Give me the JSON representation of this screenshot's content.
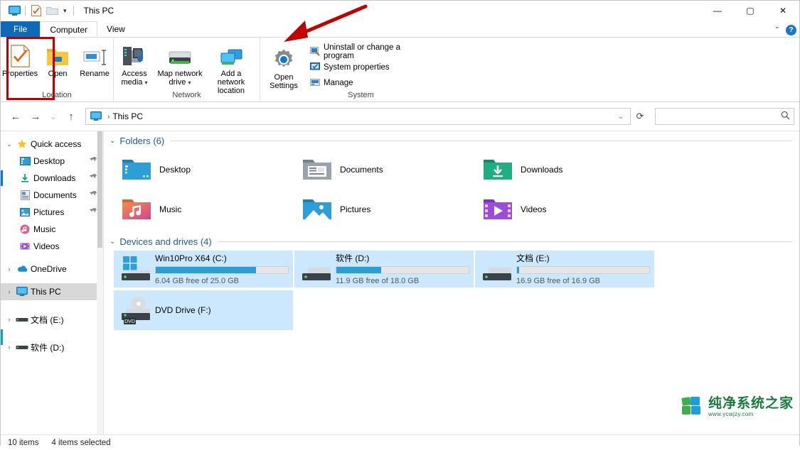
{
  "window": {
    "title": "This PC",
    "quick_access_icons": [
      "this-pc-icon",
      "properties-icon",
      "new-folder-icon"
    ],
    "qat_caret": "▾",
    "minimize": "—",
    "maximize": "▢",
    "close": "✕"
  },
  "ribbon": {
    "tabs": [
      {
        "label": "File",
        "state": "file"
      },
      {
        "label": "Computer",
        "state": "active"
      },
      {
        "label": "View",
        "state": "inactive"
      }
    ],
    "collapse_caret": "⌃",
    "help_label": "?",
    "groups": [
      {
        "name": "Location",
        "label": "Location",
        "buttons": [
          {
            "label": "Properties",
            "icon": "properties-icon"
          },
          {
            "label": "Open",
            "icon": "open-folder-icon"
          },
          {
            "label": "Rename",
            "icon": "rename-icon"
          }
        ]
      },
      {
        "name": "Network",
        "label": "Network",
        "buttons": [
          {
            "label": "Access media",
            "icon": "access-media-icon",
            "caret": "▾"
          },
          {
            "label": "Map network drive",
            "icon": "map-drive-icon",
            "caret": "▾"
          },
          {
            "label": "Add a network location",
            "icon": "add-network-location-icon",
            "caret": ""
          }
        ]
      },
      {
        "name": "System",
        "label": "System",
        "big_button": {
          "label": "Open Settings",
          "icon": "gear-icon",
          "highlighted": true
        },
        "small_buttons": [
          {
            "label": "Uninstall or change a program",
            "icon": "uninstall-icon"
          },
          {
            "label": "System properties",
            "icon": "system-properties-icon"
          },
          {
            "label": "Manage",
            "icon": "manage-icon"
          }
        ]
      }
    ]
  },
  "addressbar": {
    "back": "←",
    "forward": "→",
    "recent": "⌄",
    "up": "↑",
    "crumb_icon": "this-pc-icon",
    "crumb_sep": "›",
    "crumb_text": "This PC",
    "dropdown_caret": "⌄",
    "refresh": "⟳",
    "search_placeholder": "",
    "search_value": "",
    "search_icon": "search-icon"
  },
  "navpane": {
    "items": [
      {
        "label": "Quick access",
        "icon": "star-icon",
        "expander": "⌄",
        "indent": 0,
        "pinned": false,
        "selected": false
      },
      {
        "label": "Desktop",
        "icon": "desktop-icon",
        "expander": "",
        "indent": 1,
        "pinned": true,
        "selected": false
      },
      {
        "label": "Downloads",
        "icon": "downloads-icon",
        "expander": "",
        "indent": 1,
        "pinned": true,
        "selected": false
      },
      {
        "label": "Documents",
        "icon": "documents-icon",
        "expander": "",
        "indent": 1,
        "pinned": true,
        "selected": false
      },
      {
        "label": "Pictures",
        "icon": "pictures-icon",
        "expander": "",
        "indent": 1,
        "pinned": true,
        "selected": false
      },
      {
        "label": "Music",
        "icon": "music-icon",
        "expander": "",
        "indent": 1,
        "pinned": false,
        "selected": false
      },
      {
        "label": "Videos",
        "icon": "videos-icon",
        "expander": "",
        "indent": 1,
        "pinned": false,
        "selected": false
      },
      {
        "label": "OneDrive",
        "icon": "onedrive-icon",
        "expander": "›",
        "indent": 0,
        "pinned": false,
        "selected": false
      },
      {
        "label": "This PC",
        "icon": "this-pc-icon",
        "expander": "›",
        "indent": 0,
        "pinned": false,
        "selected": true
      },
      {
        "label": "文档 (E:)",
        "icon": "drive-icon",
        "expander": "›",
        "indent": 0,
        "pinned": false,
        "selected": false
      },
      {
        "label": "软件 (D:)",
        "icon": "drive-icon",
        "expander": "›",
        "indent": 0,
        "pinned": false,
        "selected": false
      }
    ]
  },
  "content": {
    "folders_group": {
      "chevron": "⌄",
      "title": "Folders (6)",
      "items": [
        {
          "label": "Desktop",
          "icon": "desktop-folder-icon"
        },
        {
          "label": "Documents",
          "icon": "documents-folder-icon"
        },
        {
          "label": "Downloads",
          "icon": "downloads-folder-icon"
        },
        {
          "label": "Music",
          "icon": "music-folder-icon"
        },
        {
          "label": "Pictures",
          "icon": "pictures-folder-icon"
        },
        {
          "label": "Videos",
          "icon": "videos-folder-icon"
        }
      ]
    },
    "drives_group": {
      "chevron": "⌄",
      "title": "Devices and drives (4)",
      "items": [
        {
          "name": "Win10Pro X64 (C:)",
          "free_text": "6.04 GB free of 25.0 GB",
          "used_percent": 76,
          "has_bar": true,
          "selected": true,
          "icon": "windows-drive-icon"
        },
        {
          "name": "软件 (D:)",
          "free_text": "11.9 GB free of 18.0 GB",
          "used_percent": 34,
          "has_bar": true,
          "selected": true,
          "icon": "drive-icon"
        },
        {
          "name": "文档 (E:)",
          "free_text": "16.9 GB free of 16.9 GB",
          "used_percent": 1,
          "has_bar": true,
          "selected": true,
          "icon": "drive-icon"
        },
        {
          "name": "DVD Drive (F:)",
          "free_text": "",
          "used_percent": 0,
          "has_bar": false,
          "selected": true,
          "icon": "dvd-drive-icon"
        }
      ]
    }
  },
  "statusbar": {
    "item_count": "10 items",
    "selection": "4 items selected"
  },
  "watermark": {
    "text": "纯净系统之家",
    "url": "www.ycwjzy.com",
    "icon": "site-logo-icon"
  },
  "colors": {
    "accent": "#0078d7",
    "file_tab": "#0d6ab7",
    "selection": "#cce8ff",
    "annotation_red": "#c00000",
    "group_header": "#1a5a96",
    "drive_bar": "#26a0da",
    "watermark_green": "#1a7a3c"
  }
}
